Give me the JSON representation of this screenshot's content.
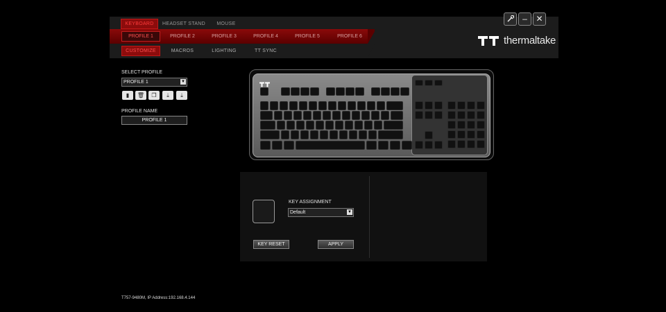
{
  "top_tabs": [
    "KEYBOARD",
    "HEADSET STAND",
    "MOUSE"
  ],
  "profile_tabs": [
    "PROFILE 1",
    "PROFILE 2",
    "PROFILE 3",
    "PROFILE 4",
    "PROFILE 5",
    "PROFILE 6"
  ],
  "sub_tabs": [
    "CUSTOMIZE",
    "MACROS",
    "LIGHTING",
    "TT SYNC"
  ],
  "window_controls": {
    "settings": "settings-icon",
    "minimize": "–",
    "close": "✕"
  },
  "brand": {
    "name": "thermaltake",
    "logo": "tt-logo-icon"
  },
  "sidebar": {
    "select_profile_label": "SELECT PROFILE",
    "selected_profile": "PROFILE 1",
    "profile_name_label": "PROFILE NAME",
    "profile_name_value": "PROFILE 1",
    "actions": [
      "new-profile-icon",
      "delete-icon",
      "copy-icon",
      "import-icon",
      "export-icon"
    ]
  },
  "key_panel": {
    "assignment_label": "KEY ASSIGNMENT",
    "assignment_value": "Default",
    "reset_label": "KEY RESET",
    "apply_label": "APPLY"
  },
  "footer": {
    "device_info": "T757-9480M, IP Address:192.168.4.144"
  },
  "colors": {
    "accent_red": "#c01818",
    "background": "#000000"
  }
}
